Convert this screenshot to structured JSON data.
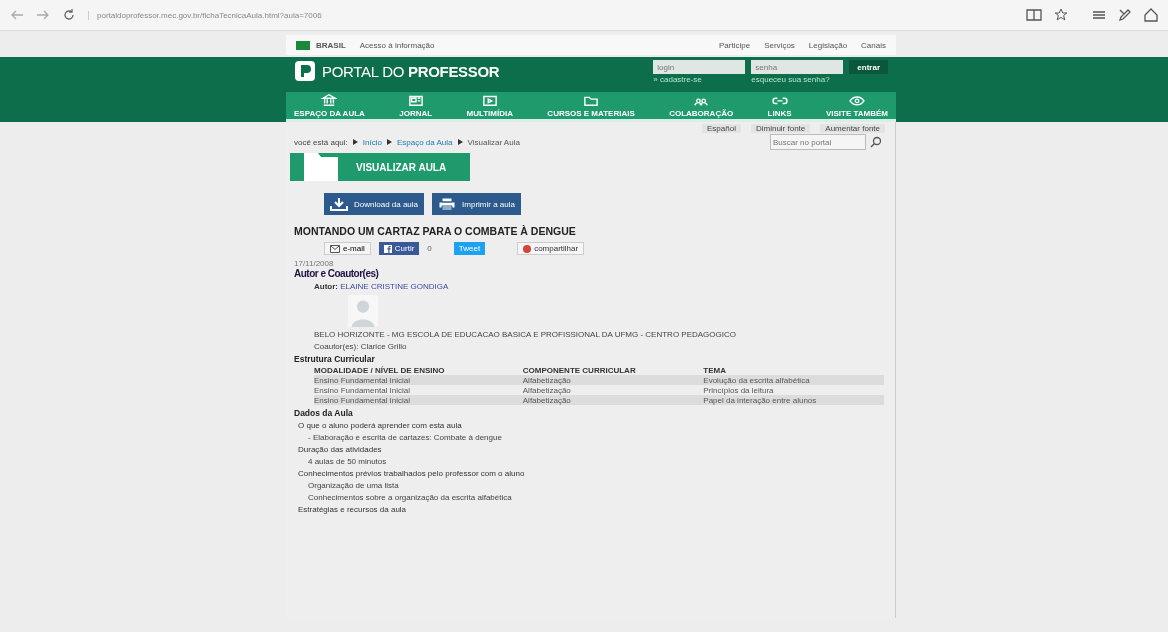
{
  "browser": {
    "url": "portaldoprofessor.mec.gov.br/fichaTecnicaAula.html?aula=7006"
  },
  "gov_bar": {
    "brand": "BRASIL",
    "access": "Acesso à informação",
    "links": [
      "Participe",
      "Serviços",
      "Legislação",
      "Canais"
    ]
  },
  "header": {
    "logo_light": "PORTAL DO",
    "logo_bold": "PROFESSOR",
    "login_placeholder": "login",
    "password_placeholder": "senha",
    "submit": "entrar",
    "register": "» cadastre-se",
    "forgot": "esqueceu sua senha?"
  },
  "nav": [
    "ESPAÇO DA AULA",
    "JORNAL",
    "MULTIMÍDIA",
    "CURSOS E MATERIAIS",
    "COLABORAÇÃO",
    "LINKS",
    "VISITE TAMBÉM"
  ],
  "tools": {
    "language": "Español",
    "decrease": "Diminuir fonte",
    "increase": "Aumentar fonte",
    "search_placeholder": "Buscar no portal"
  },
  "breadcrumb": {
    "prefix": "você está aqui:",
    "items": [
      "Início",
      "Espaço da Aula",
      "Visualizar Aula"
    ]
  },
  "page_title": "VISUALIZAR AULA",
  "actions": [
    "Download da aula",
    "Imprimir a aula"
  ],
  "lesson": {
    "title": "MONTANDO UM CARTAZ PARA O COMBATE À DENGUE",
    "email": "e-mail",
    "like": "Curtir",
    "like_count": "0",
    "tweet": "Tweet",
    "share": "compartilhar",
    "date": "17/11/2008",
    "authors_heading": "Autor e Coautor(es)",
    "author_label": "Autor:",
    "author_name": "ELAINE CRISTINE GONDIGA",
    "school": "BELO HORIZONTE - MG ESCOLA DE EDUCACAO BASICA E PROFISSIONAL DA UFMG - CENTRO PEDAGOGICO",
    "coauthors": "Coautor(es): Clarice Grillo"
  },
  "curriculum": {
    "heading": "Estrutura Curricular",
    "columns": [
      "MODALIDADE / NÍVEL DE ENSINO",
      "COMPONENTE CURRICULAR",
      "TEMA"
    ],
    "rows": [
      [
        "Ensino Fundamental Inicial",
        "Alfabetização",
        "Evolução da escrita alfabética"
      ],
      [
        "Ensino Fundamental Inicial",
        "Alfabetização",
        "Princípios da leitura"
      ],
      [
        "Ensino Fundamental Inicial",
        "Alfabetização",
        "Papel da interação entre alunos"
      ]
    ]
  },
  "details": {
    "heading": "Dados da Aula",
    "blocks": [
      {
        "kind": "label",
        "text": "O que o aluno poderá aprender com esta aula"
      },
      {
        "kind": "item",
        "text": "- Elaboração e escrita de cartazes: Combate à dengue"
      },
      {
        "kind": "label",
        "text": "Duração das atividades"
      },
      {
        "kind": "item",
        "text": "4 aulas de 50 minutos"
      },
      {
        "kind": "label",
        "text": "Conhecimentos prévios trabalhados pelo professor com o aluno"
      },
      {
        "kind": "item",
        "text": "Organização de uma lista"
      },
      {
        "kind": "item",
        "text": "Conhecimentos sobre a organização da escrita alfabética"
      },
      {
        "kind": "label",
        "text": "Estratégias e recursos da aula"
      }
    ]
  }
}
